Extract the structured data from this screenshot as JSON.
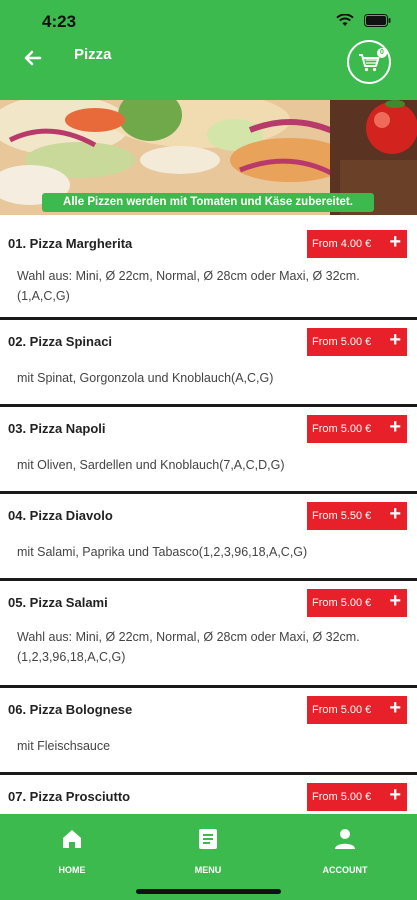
{
  "status_bar": {
    "time": "4:23"
  },
  "app_bar": {
    "title": "Pizza",
    "cart_count": "0"
  },
  "banner": {
    "note": "Alle Pizzen werden mit Tomaten und Käse zubereitet."
  },
  "items": [
    {
      "name": "01. Pizza Margherita",
      "price": "From 4.00 €",
      "desc": "Wahl aus: Mini, Ø 22cm, Normal, Ø 28cm oder Maxi, Ø 32cm. (1,A,C,G)"
    },
    {
      "name": "02. Pizza Spinaci",
      "price": "From 5.00 €",
      "desc": "mit Spinat, Gorgonzola und Knoblauch(A,C,G)"
    },
    {
      "name": "03. Pizza Napoli",
      "price": "From 5.00 €",
      "desc": "mit Oliven, Sardellen und Knoblauch(7,A,C,D,G)"
    },
    {
      "name": "04. Pizza Diavolo",
      "price": "From 5.50 €",
      "desc": "mit Salami, Paprika und Tabasco(1,2,3,96,18,A,C,G)"
    },
    {
      "name": "05. Pizza Salami",
      "price": "From 5.00 €",
      "desc": "Wahl aus: Mini, Ø 22cm, Normal, Ø 28cm oder Maxi, Ø 32cm. (1,2,3,96,18,A,C,G)"
    },
    {
      "name": "06. Pizza Bolognese",
      "price": "From 5.00 €",
      "desc": "mit Fleischsauce"
    },
    {
      "name": "07. Pizza Prosciutto",
      "price": "From 5.00 €",
      "desc": ""
    }
  ],
  "price_plus": "+",
  "bottom_nav": {
    "home": "HOME",
    "menu": "MENU",
    "account": "ACCOUNT"
  },
  "colors": {
    "brand_green": "#3dba4e",
    "price_red": "#e8202a"
  }
}
